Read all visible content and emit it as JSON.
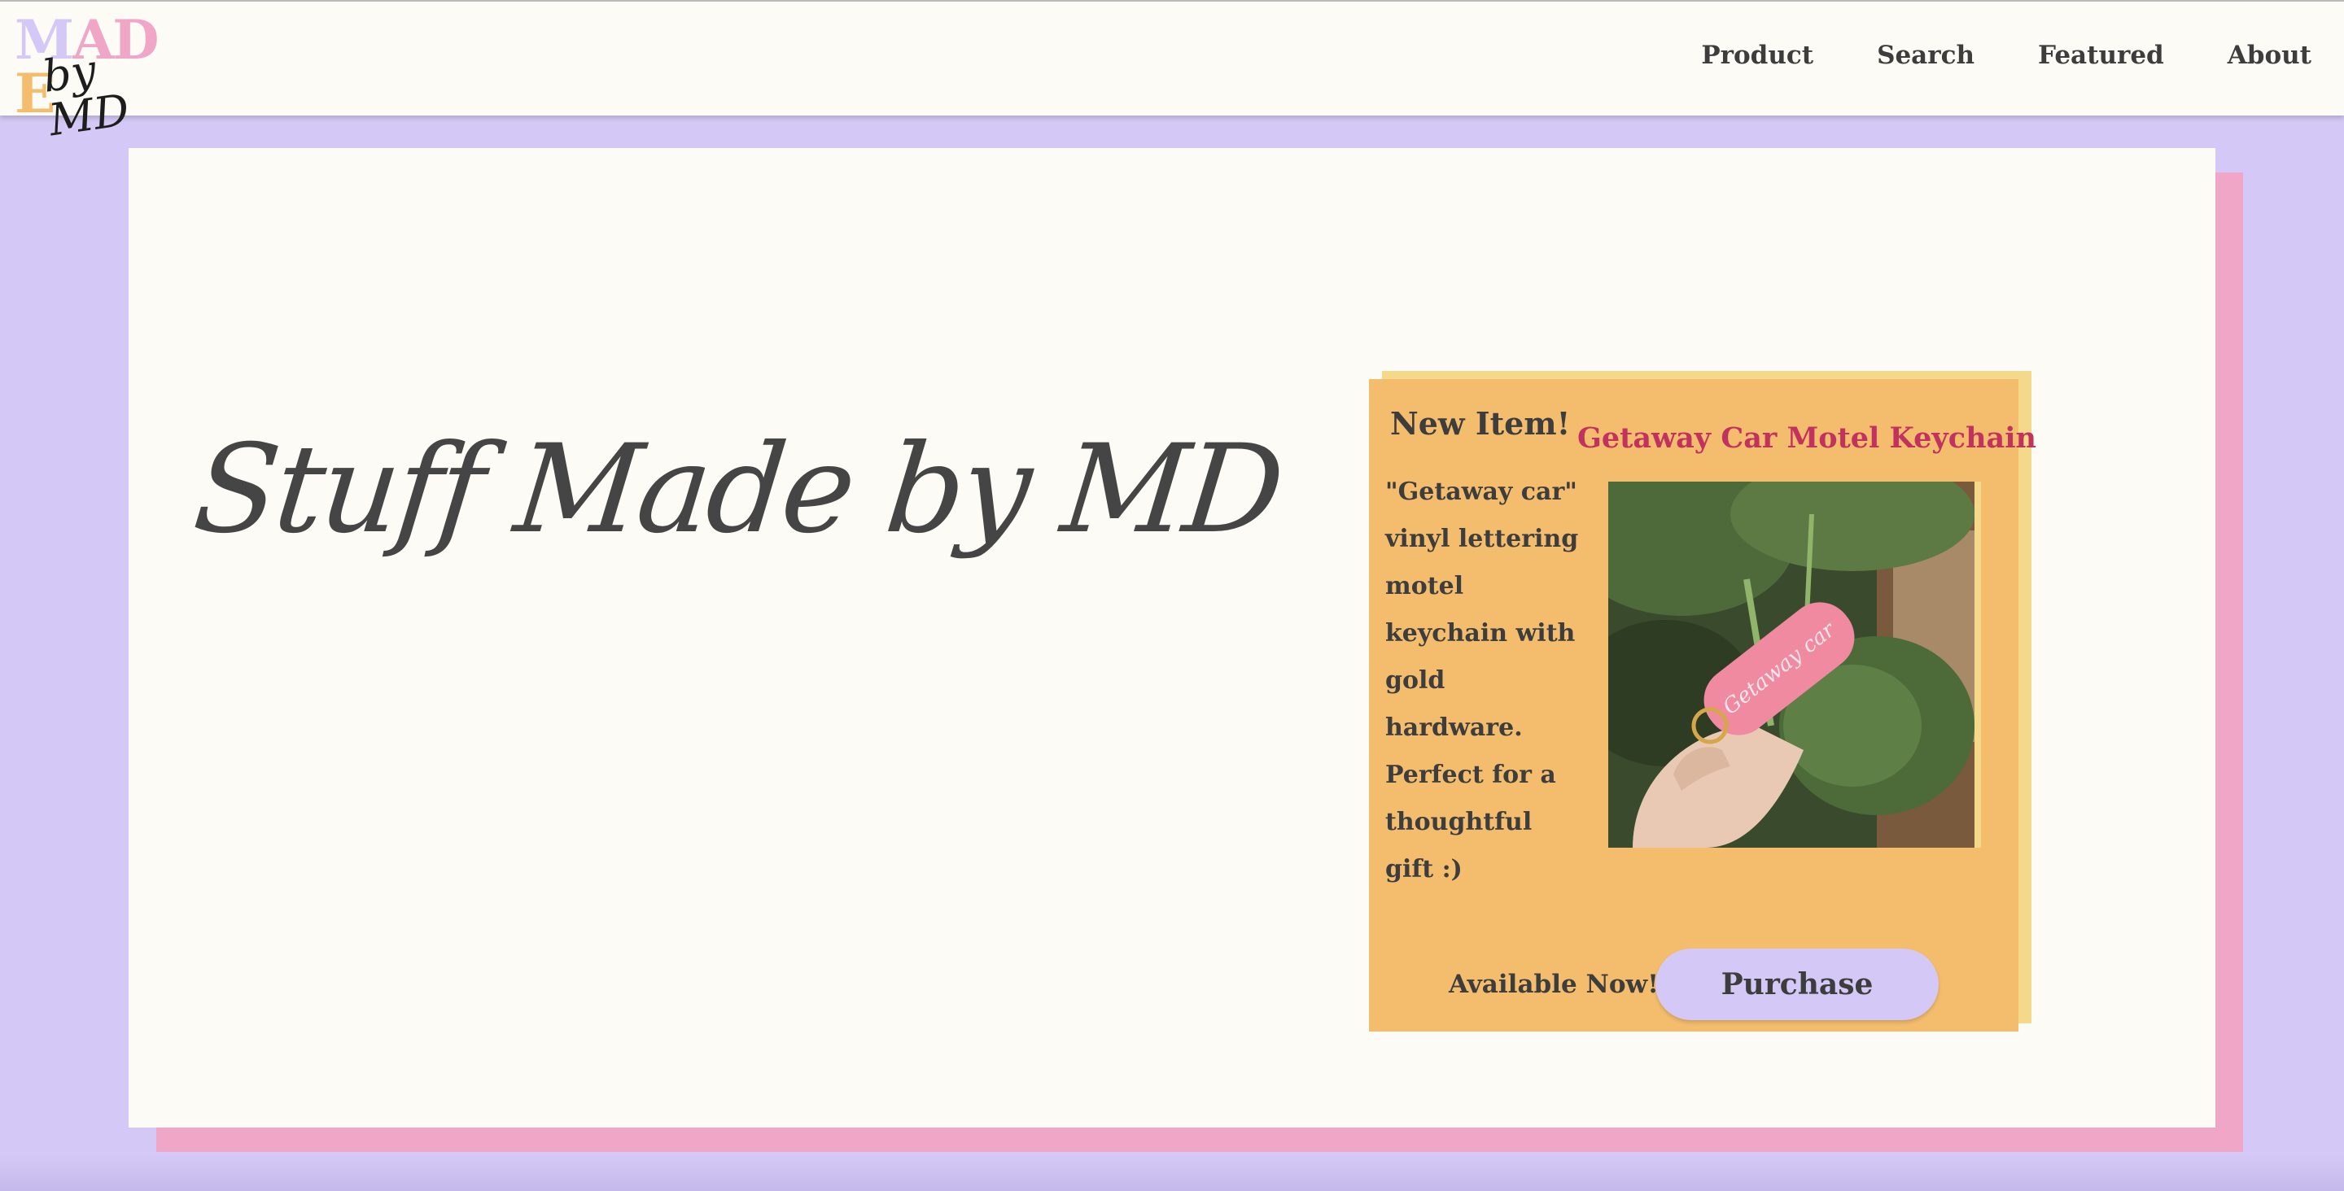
{
  "logo": {
    "made_letters": [
      "M",
      "A",
      "D",
      "E"
    ],
    "made_colors": [
      "#d4c9f6",
      "#f0a6c7",
      "#f0a6c7",
      "#f4bd6e"
    ],
    "by_text": "by MD"
  },
  "nav": {
    "items": [
      {
        "label": "Product"
      },
      {
        "label": "Search"
      },
      {
        "label": "Featured"
      },
      {
        "label": "About"
      }
    ]
  },
  "hero": {
    "title": "Stuff Made by MD"
  },
  "featured": {
    "badge": "New Item!",
    "name": "Getaway Car Motel Keychain",
    "description": "\"Getaway car\" vinyl lettering motel keychain with gold hardware. Perfect for a thoughtful gift :)",
    "photo_keychain_text": "Getaway car",
    "availability": "Available Now!",
    "purchase_label": "Purchase"
  },
  "colors": {
    "background": "#d4c9f6",
    "card": "#fcfbf5",
    "pink_accent": "#f0a6c7",
    "orange_card": "#f4bd6e",
    "yellow_accent": "#f5d98a",
    "title_red": "#c2325f",
    "text_dark": "#3d3d3d"
  }
}
